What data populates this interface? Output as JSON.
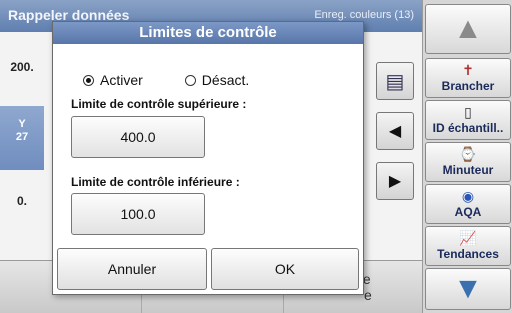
{
  "background": {
    "header_title": "Rappeler données",
    "header_right": "Enreg. couleurs (13)",
    "row1_value": "200.",
    "row2_line1": "Y",
    "row2_line2": "27",
    "row3_value": "0.",
    "bottom_label_line1": "ôle",
    "bottom_label_line2": "e"
  },
  "modal": {
    "title": "Limites de contrôle",
    "radio_on_label": "Activer",
    "radio_off_label": "Désact.",
    "upper_label": "Limite de contrôle supérieure :",
    "upper_value": "400.0",
    "lower_label": "Limite de contrôle inférieure :",
    "lower_value": "100.0",
    "cancel_label": "Annuler",
    "ok_label": "OK"
  },
  "toolbar": {
    "up_arrow": "▲",
    "connect_label": "Brancher",
    "sample_id_label": "ID échantill..",
    "timer_label": "Minuteur",
    "aqa_label": "AQA",
    "trends_label": "Tendances",
    "down_arrow": "▼"
  },
  "colors": {
    "header_blue": "#5f7fb0",
    "toolbar_text": "#1a2a5a"
  }
}
